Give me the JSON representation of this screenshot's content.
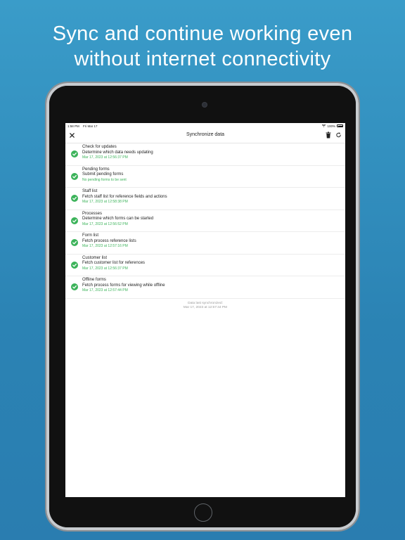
{
  "headline": {
    "line1": "Sync and continue working even",
    "line2": "without internet connectivity"
  },
  "status_bar": {
    "time": "1:58 PM",
    "date": "Fri Mar 17",
    "battery": "100%"
  },
  "navbar": {
    "title": "Synchronize data",
    "close_icon": "close-icon",
    "trash_icon": "trash-icon",
    "refresh_icon": "refresh-icon"
  },
  "items": [
    {
      "title": "Check for updates",
      "desc": "Determine which data needs updating",
      "status": "Mar 17, 2023 at 12:56:37 PM"
    },
    {
      "title": "Pending forms",
      "desc": "Submit pending forms",
      "status": "No pending forms to be sent"
    },
    {
      "title": "Staff list",
      "desc": "Fetch staff list for reference fields and actions",
      "status": "Mar 17, 2023 at 12:58:38 PM"
    },
    {
      "title": "Processes",
      "desc": "Determine which forms can be started",
      "status": "Mar 17, 2023 at 12:56:52 PM"
    },
    {
      "title": "Form list",
      "desc": "Fetch process reference lists",
      "status": "Mar 17, 2023 at 12:57:16 PM"
    },
    {
      "title": "Customer list",
      "desc": "Fetch customer list for references",
      "status": "Mar 17, 2023 at 12:56:37 PM"
    },
    {
      "title": "Offline forms",
      "desc": "Fetch process forms for viewing while offline",
      "status": "Mar 17, 2023 at 12:57:44 PM"
    }
  ],
  "footer": {
    "label": "Data last synchronized:",
    "value": "Mar 17, 2023 at 12:57:44 PM"
  },
  "colors": {
    "success": "#3cb35a",
    "background": "#2b83b4"
  }
}
